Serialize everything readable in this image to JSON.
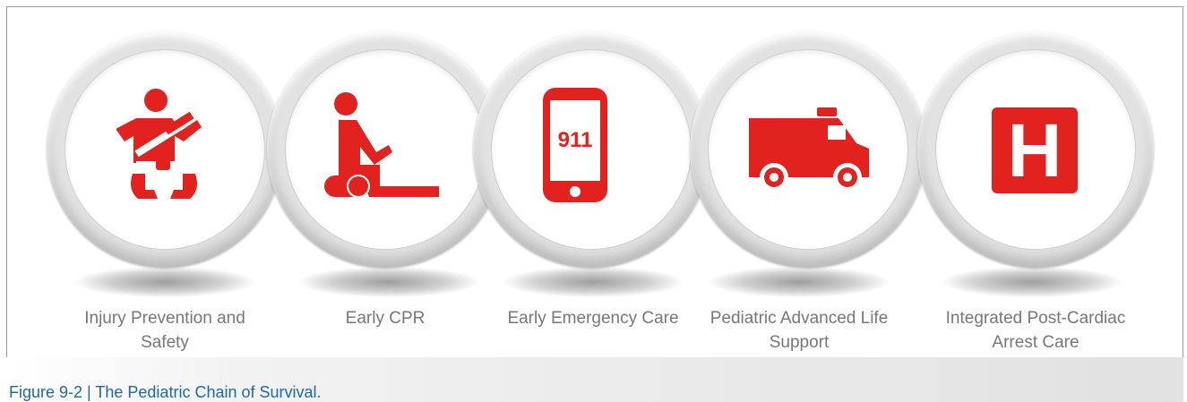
{
  "colors": {
    "icon_red": "#e1221f",
    "label_gray": "#777777",
    "caption_blue": "#1b6aa3"
  },
  "steps": [
    {
      "label": "Injury Prevention and Safety",
      "icon": "infant-car-seat-icon"
    },
    {
      "label": "Early CPR",
      "icon": "cpr-icon"
    },
    {
      "label": "Early Emergency Care",
      "icon": "phone-911-icon",
      "icon_text": "911"
    },
    {
      "label": "Pediatric Advanced Life Support",
      "icon": "ambulance-icon"
    },
    {
      "label": "Integrated Post-Cardiac Arrest Care",
      "icon": "hospital-icon",
      "icon_text": "H"
    }
  ],
  "caption": "Figure 9-2  | The Pediatric Chain of Survival."
}
